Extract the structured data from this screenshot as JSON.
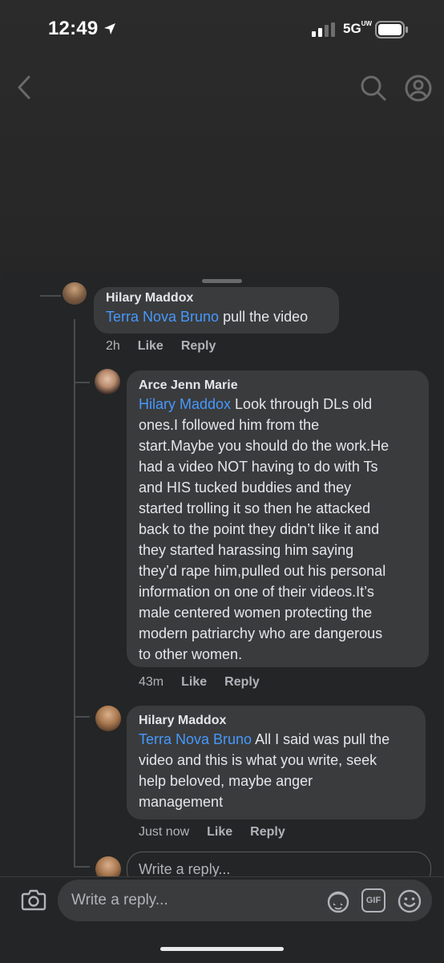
{
  "status_bar": {
    "time": "12:49",
    "network": "5G",
    "network_sup": "UW"
  },
  "colors": {
    "background": "#1c1c1e",
    "sheet": "#242526",
    "bubble": "#3a3b3c",
    "mention": "#4599ff",
    "meta_text": "#b0b3b8"
  },
  "icons": [
    "location-arrow-icon",
    "signal-icon",
    "battery-icon",
    "back-icon",
    "search-icon",
    "profile-icon",
    "camera-icon",
    "sticker-icon",
    "gif-icon",
    "emoji-icon"
  ],
  "comments": [
    {
      "author": "Hilary Maddox",
      "mention": "Terra Nova Bruno",
      "body": " pull the video",
      "time": "2h",
      "like": "Like",
      "reply": "Reply"
    },
    {
      "author": "Arce Jenn Marie",
      "mention": "Hilary Maddox",
      "body_lines": [
        " Look through DLs old",
        "ones.I followed him from the",
        "start.Maybe you should do the work.He",
        "had a video NOT having to do with Ts",
        "and HIS tucked buddies and they",
        "started trolling it so then he attacked",
        "back to the point they didn’t like it and",
        "they started harassing him saying",
        "they’d rape him,pulled out his personal",
        "information on one of their videos.It’s",
        "male centered women protecting the",
        "modern patriarchy who are dangerous",
        "to other women."
      ],
      "time": "43m",
      "like": "Like",
      "reply": "Reply"
    },
    {
      "author": "Hilary Maddox",
      "mention": "Terra Nova Bruno",
      "body_lines": [
        " All I said was pull the",
        "video and this is what you write, seek",
        "help beloved, maybe anger",
        "management"
      ],
      "time": "Just now",
      "like": "Like",
      "reply": "Reply"
    }
  ],
  "reply_input_placeholder": "Write a reply...",
  "gif_label": "GIF"
}
